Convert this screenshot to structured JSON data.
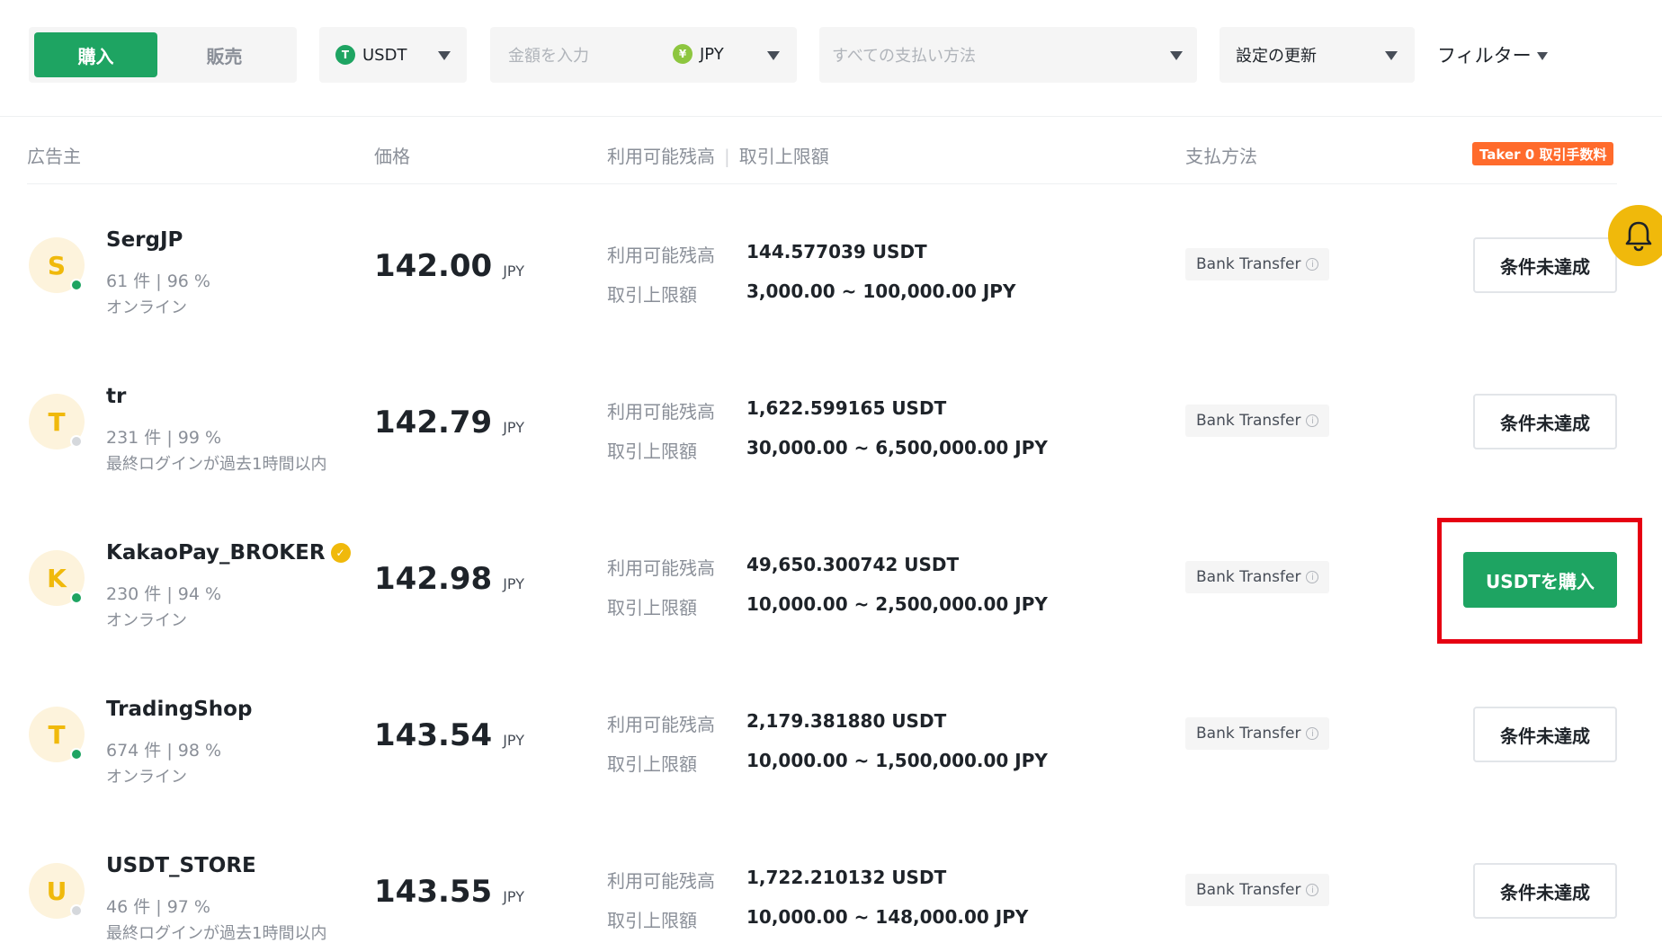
{
  "toolbar": {
    "buy_tab": "購入",
    "sell_tab": "販売",
    "crypto": {
      "label": "USDT",
      "icon_glyph": "T",
      "icon_color": "#1ea462"
    },
    "amount": {
      "placeholder": "金額を入力",
      "currency": "JPY",
      "currency_icon_glyph": "¥"
    },
    "payment_method_placeholder": "すべての支払い方法",
    "refresh_label": "設定の更新",
    "filter_label": "フィルター"
  },
  "table_header": {
    "advertiser": "広告主",
    "price": "価格",
    "available": "利用可能残高",
    "limit": "取引上限額",
    "payment": "支払方法",
    "taker_badge": "Taker 0 取引手数料"
  },
  "labels": {
    "available": "利用可能残高",
    "limit": "取引上限額"
  },
  "colors": {
    "brand_green": "#1ea462",
    "accent_yellow": "#f0b90b",
    "badge_orange": "#ff6b2c",
    "highlight_red": "#e60012"
  },
  "ads": [
    {
      "initial": "S",
      "name": "SergJP",
      "verified": false,
      "stats": "61 件 | 96 %",
      "status": "オンライン",
      "online": true,
      "price": "142.00",
      "currency": "JPY",
      "available": "144.577039 USDT",
      "limit": "3,000.00 ~ 100,000.00 JPY",
      "payment": "Bank Transfer",
      "action": "条件未達成",
      "action_primary": false
    },
    {
      "initial": "T",
      "name": "tr",
      "verified": false,
      "stats": "231 件 | 99 %",
      "status": "最終ログインが過去1時間以内",
      "online": false,
      "price": "142.79",
      "currency": "JPY",
      "available": "1,622.599165 USDT",
      "limit": "30,000.00 ~ 6,500,000.00 JPY",
      "payment": "Bank Transfer",
      "action": "条件未達成",
      "action_primary": false
    },
    {
      "initial": "K",
      "name": "KakaoPay_BROKER",
      "verified": true,
      "stats": "230 件 | 94 %",
      "status": "オンライン",
      "online": true,
      "price": "142.98",
      "currency": "JPY",
      "available": "49,650.300742 USDT",
      "limit": "10,000.00 ~ 2,500,000.00 JPY",
      "payment": "Bank Transfer",
      "action": "USDTを購入",
      "action_primary": true
    },
    {
      "initial": "T",
      "name": "TradingShop",
      "verified": false,
      "stats": "674 件 | 98 %",
      "status": "オンライン",
      "online": true,
      "price": "143.54",
      "currency": "JPY",
      "available": "2,179.381880 USDT",
      "limit": "10,000.00 ~ 1,500,000.00 JPY",
      "payment": "Bank Transfer",
      "action": "条件未達成",
      "action_primary": false
    },
    {
      "initial": "U",
      "name": "USDT_STORE",
      "verified": false,
      "stats": "46 件 | 97 %",
      "status": "最終ログインが過去1時間以内",
      "online": false,
      "price": "143.55",
      "currency": "JPY",
      "available": "1,722.210132 USDT",
      "limit": "10,000.00 ~ 148,000.00 JPY",
      "payment": "Bank Transfer",
      "action": "条件未達成",
      "action_primary": false
    }
  ]
}
